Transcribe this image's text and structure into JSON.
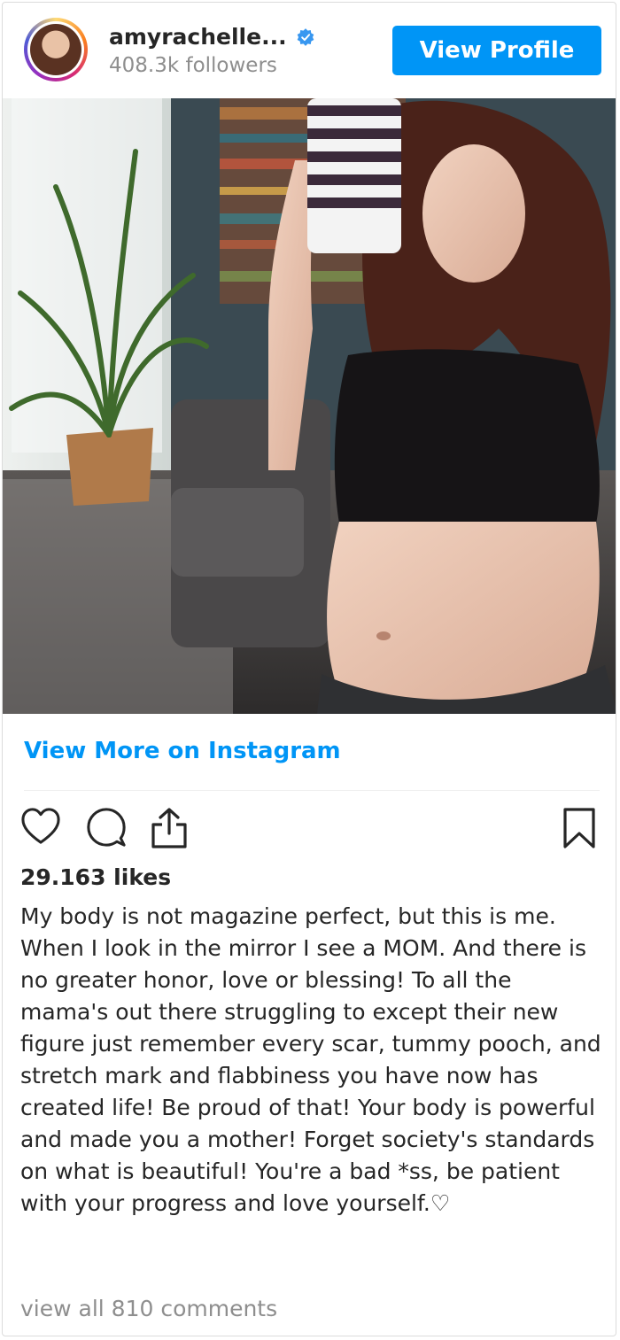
{
  "header": {
    "username": "amyrachelle...",
    "followers": "408.3k followers",
    "view_profile_label": "View Profile",
    "verified_icon": "verified-badge-icon"
  },
  "post": {
    "view_more_label": "View More on Instagram",
    "likes": "29.163 likes",
    "caption": "My body is not magazine perfect, but this is me. When I look in the mirror I see a MOM. And there is no greater honor, love or blessing! To all the mama's out there struggling to except their new figure just remember every scar, tummy pooch, and stretch mark and flabbiness you have now has created life! Be proud of that! Your body is powerful and made you a mother! Forget society's standards on what is beautiful! You're a bad *ss, be patient with your progress and love yourself.♡",
    "view_comments": "view all 810 comments"
  },
  "actions": {
    "like_icon": "heart-icon",
    "comment_icon": "comment-icon",
    "share_icon": "share-icon",
    "save_icon": "bookmark-icon"
  },
  "colors": {
    "accent": "#0095f6",
    "text": "#262626",
    "muted": "#8e8e8e"
  }
}
